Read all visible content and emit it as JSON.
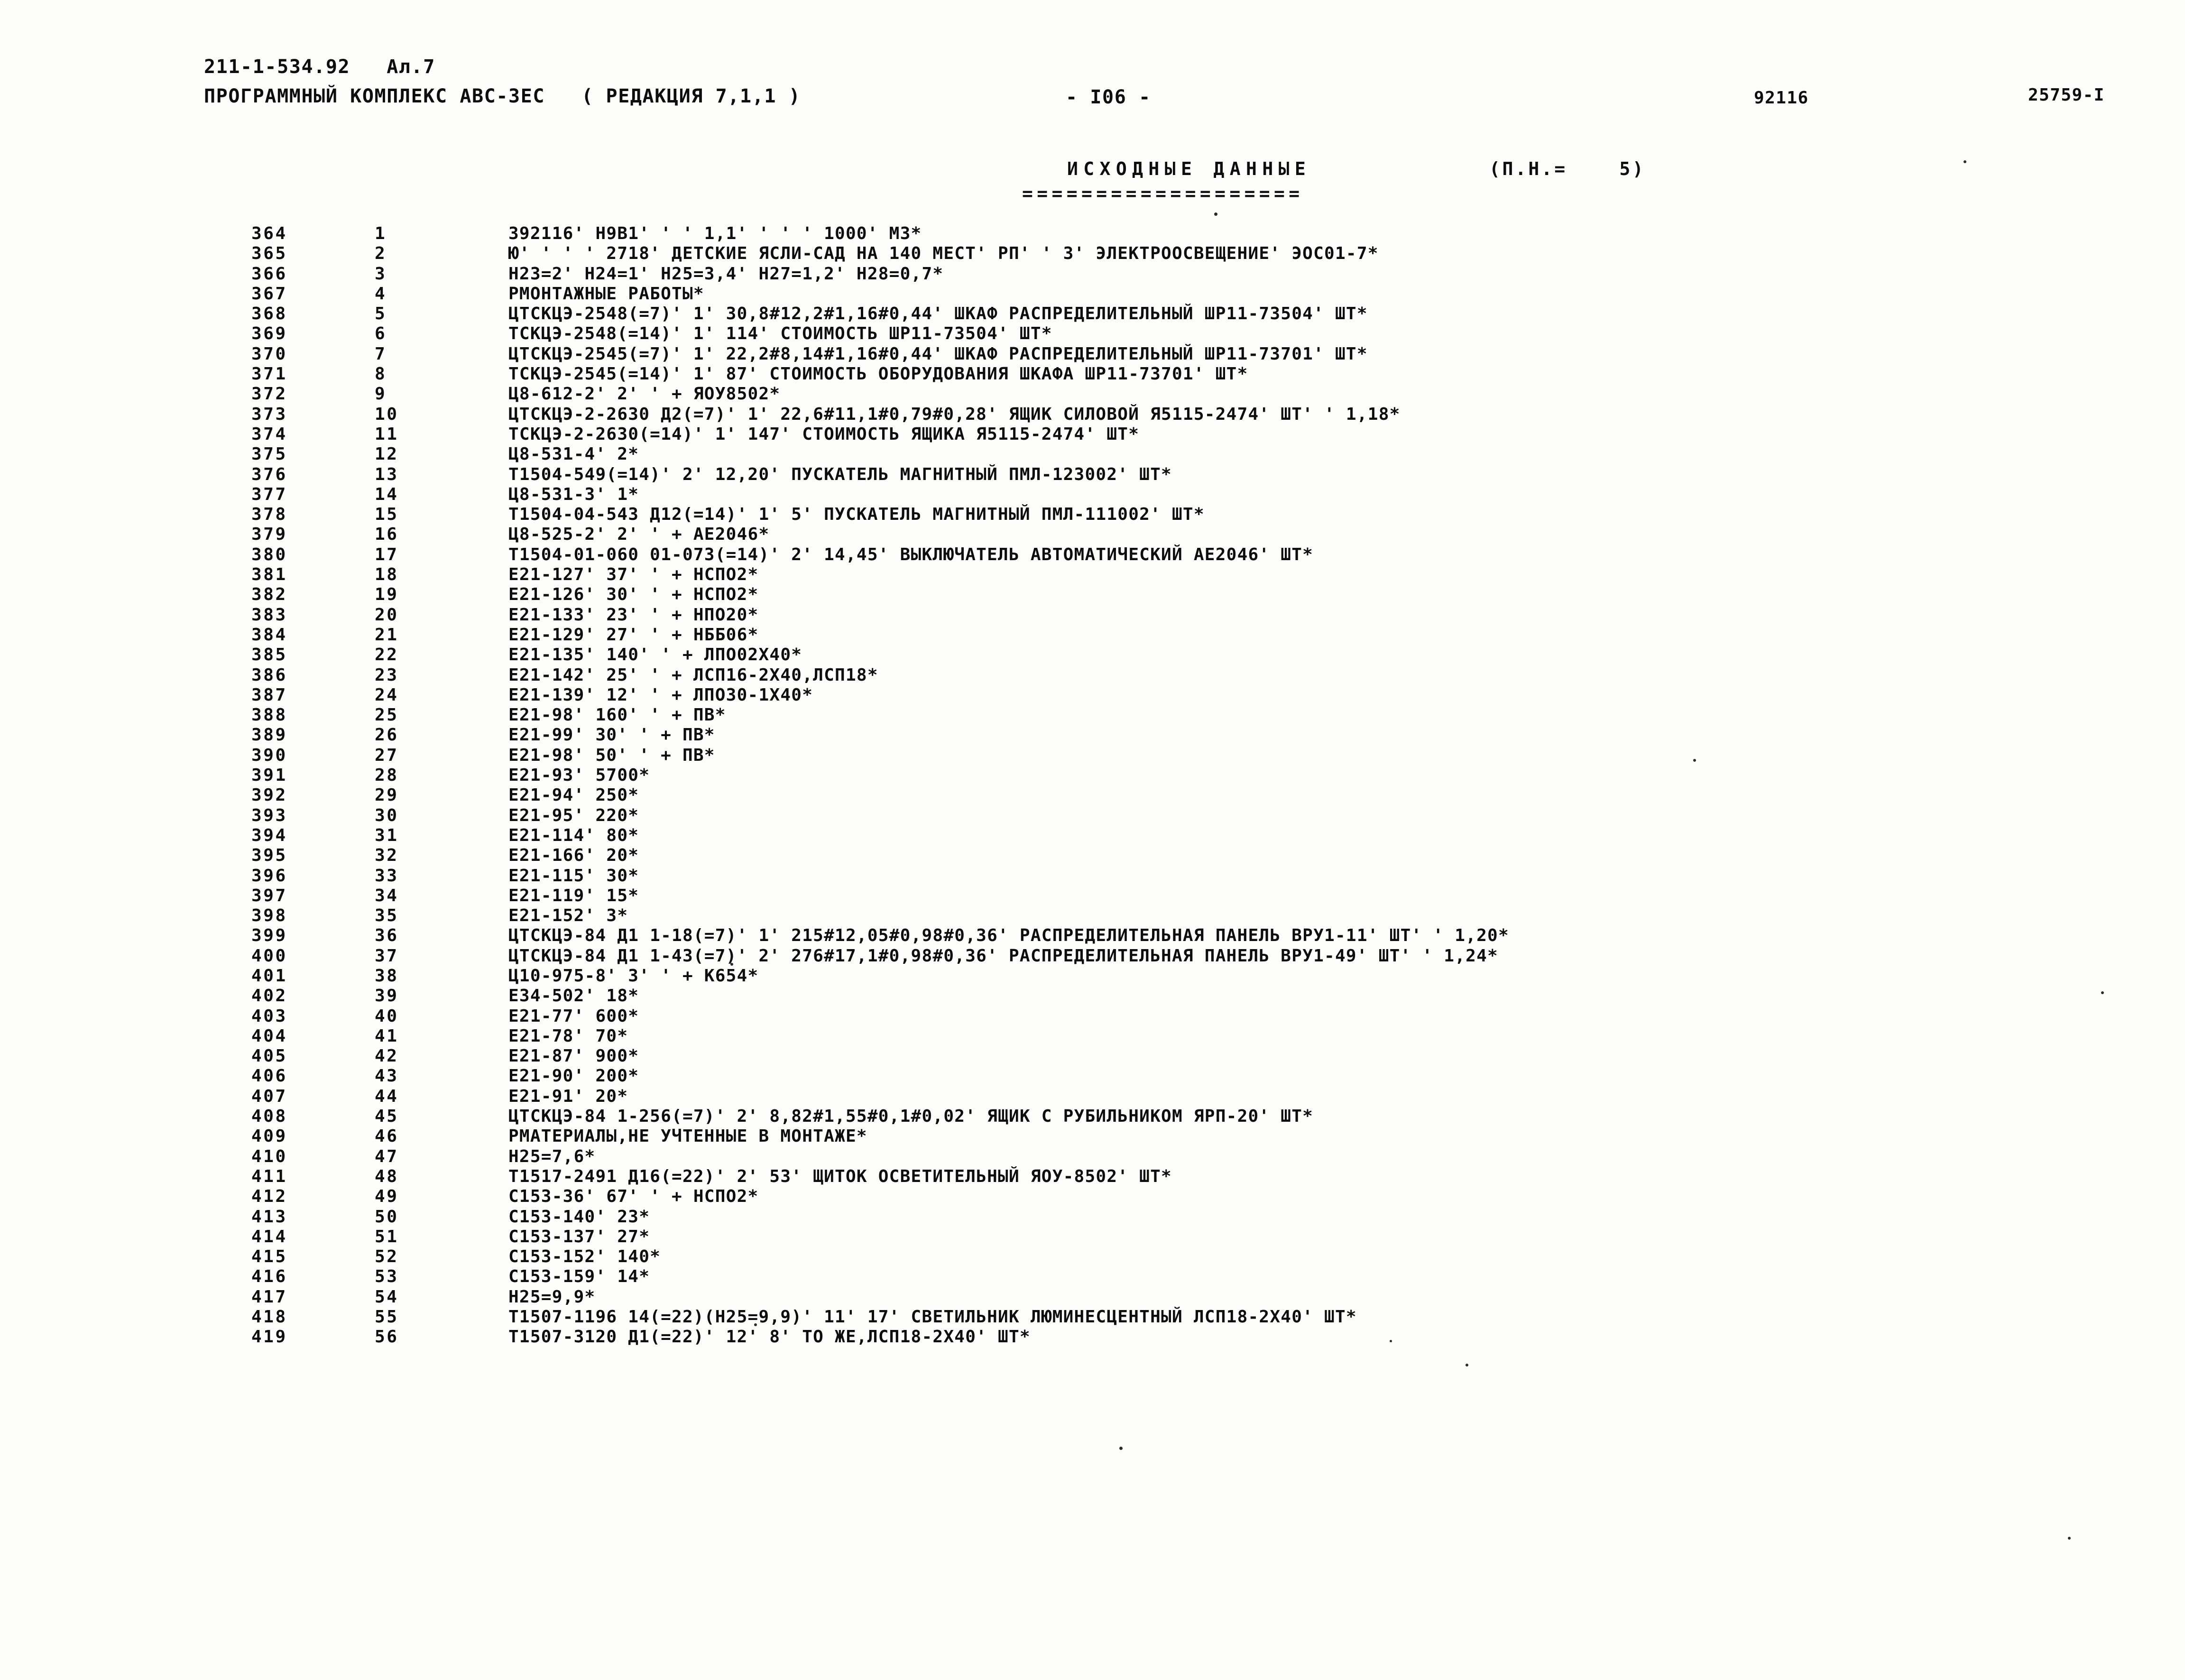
{
  "header": {
    "doc_code": "211-1-534.92   Ал.7",
    "program_title": "ПРОГРАММНЫЙ КОМПЛЕКС АВС-ЗЕС   ( РЕДАКЦИЯ 7,1,1 )",
    "page_number": "- I06 -",
    "order_number": "92116",
    "sheet_number": "25759-I"
  },
  "section": {
    "title": "ИСХОДНЫЕ ДАННЫЕ",
    "param": "(П.Н.=    5)",
    "rule": "==================="
  },
  "listing": {
    "columns": [
      "line_no",
      "seq_no",
      "text"
    ],
    "rows": [
      {
        "line_no": "364",
        "seq_no": "1",
        "text": "392116' Н9В1' ' ' 1,1' ' ' ' 1000' М3*"
      },
      {
        "line_no": "365",
        "seq_no": "2",
        "text": "Ю' ' ' ' 2718' ДЕТСКИЕ ЯСЛИ-САД НА 140 МЕСТ' РП' ' 3' ЭЛЕКТРООСВЕЩЕНИЕ' ЭОС01-7*"
      },
      {
        "line_no": "366",
        "seq_no": "3",
        "text": "Н23=2' Н24=1' Н25=3,4' Н27=1,2' Н28=0,7*"
      },
      {
        "line_no": "367",
        "seq_no": "4",
        "text": "РМОНТАЖНЫЕ РАБОТЫ*"
      },
      {
        "line_no": "368",
        "seq_no": "5",
        "text": "ЦТСКЦЭ-2548(=7)' 1' 30,8#12,2#1,16#0,44' ШКАФ РАСПРЕДЕЛИТЕЛЬНЫЙ ШР11-73504' ШТ*"
      },
      {
        "line_no": "369",
        "seq_no": "6",
        "text": "ТСКЦЭ-2548(=14)' 1' 114' СТОИМОСТЬ ШР11-73504' ШТ*"
      },
      {
        "line_no": "370",
        "seq_no": "7",
        "text": "ЦТСКЦЭ-2545(=7)' 1' 22,2#8,14#1,16#0,44' ШКАФ РАСПРЕДЕЛИТЕЛЬНЫЙ ШР11-73701' ШТ*"
      },
      {
        "line_no": "371",
        "seq_no": "8",
        "text": "ТСКЦЭ-2545(=14)' 1' 87' СТОИМОСТЬ ОБОРУДОВАНИЯ ШКАФА ШР11-73701' ШТ*"
      },
      {
        "line_no": "372",
        "seq_no": "9",
        "text": "Ц8-612-2' 2' ' + ЯОУ8502*"
      },
      {
        "line_no": "373",
        "seq_no": "10",
        "text": "ЦТСКЦЭ-2-2630 Д2(=7)' 1' 22,6#11,1#0,79#0,28' ЯЩИК СИЛОВОЙ Я5115-2474' ШТ' ' 1,18*"
      },
      {
        "line_no": "374",
        "seq_no": "11",
        "text": "ТСКЦЭ-2-2630(=14)' 1' 147' СТОИМОСТЬ ЯЩИКА Я5115-2474' ШТ*"
      },
      {
        "line_no": "375",
        "seq_no": "12",
        "text": "Ц8-531-4' 2*"
      },
      {
        "line_no": "376",
        "seq_no": "13",
        "text": "Т1504-549(=14)' 2' 12,20' ПУСКАТЕЛЬ МАГНИТНЫЙ ПМЛ-123002' ШТ*"
      },
      {
        "line_no": "377",
        "seq_no": "14",
        "text": "Ц8-531-3' 1*"
      },
      {
        "line_no": "378",
        "seq_no": "15",
        "text": "Т1504-04-543 Д12(=14)' 1' 5' ПУСКАТЕЛЬ МАГНИТНЫЙ ПМЛ-111002' ШТ*"
      },
      {
        "line_no": "379",
        "seq_no": "16",
        "text": "Ц8-525-2' 2' ' + АЕ2046*"
      },
      {
        "line_no": "380",
        "seq_no": "17",
        "text": "Т1504-01-060 01-073(=14)' 2' 14,45' ВЫКЛЮЧАТЕЛЬ АВТОМАТИЧЕСКИЙ АЕ2046' ШТ*"
      },
      {
        "line_no": "381",
        "seq_no": "18",
        "text": "Е21-127' 37' ' + НСПО2*"
      },
      {
        "line_no": "382",
        "seq_no": "19",
        "text": "Е21-126' 30' ' + НСПО2*"
      },
      {
        "line_no": "383",
        "seq_no": "20",
        "text": "Е21-133' 23' ' + НПО20*"
      },
      {
        "line_no": "384",
        "seq_no": "21",
        "text": "Е21-129' 27' ' + НББ06*"
      },
      {
        "line_no": "385",
        "seq_no": "22",
        "text": "Е21-135' 140' ' + ЛПО02Х40*"
      },
      {
        "line_no": "386",
        "seq_no": "23",
        "text": "Е21-142' 25' ' + ЛСП16-2Х40,ЛСП18*"
      },
      {
        "line_no": "387",
        "seq_no": "24",
        "text": "Е21-139' 12' ' + ЛПО30-1Х40*"
      },
      {
        "line_no": "388",
        "seq_no": "25",
        "text": "Е21-98' 160' ' + ПВ*"
      },
      {
        "line_no": "389",
        "seq_no": "26",
        "text": "Е21-99' 30' ' + ПВ*"
      },
      {
        "line_no": "390",
        "seq_no": "27",
        "text": "Е21-98' 50' ' + ПВ*"
      },
      {
        "line_no": "391",
        "seq_no": "28",
        "text": "Е21-93' 5700*"
      },
      {
        "line_no": "392",
        "seq_no": "29",
        "text": "Е21-94' 250*"
      },
      {
        "line_no": "393",
        "seq_no": "30",
        "text": "Е21-95' 220*"
      },
      {
        "line_no": "394",
        "seq_no": "31",
        "text": "Е21-114' 80*"
      },
      {
        "line_no": "395",
        "seq_no": "32",
        "text": "Е21-166' 20*"
      },
      {
        "line_no": "396",
        "seq_no": "33",
        "text": "Е21-115' 30*"
      },
      {
        "line_no": "397",
        "seq_no": "34",
        "text": "Е21-119' 15*"
      },
      {
        "line_no": "398",
        "seq_no": "35",
        "text": "Е21-152' 3*"
      },
      {
        "line_no": "399",
        "seq_no": "36",
        "text": "ЦТСКЦЭ-84 Д1 1-18(=7)' 1' 215#12,05#0,98#0,36' РАСПРЕДЕЛИТЕЛЬНАЯ ПАНЕЛЬ ВРУ1-11' ШТ' ' 1,20*"
      },
      {
        "line_no": "400",
        "seq_no": "37",
        "text": "ЦТСКЦЭ-84 Д1 1-43(=7)' 2' 276#17,1#0,98#0,36' РАСПРЕДЕЛИТЕЛЬНАЯ ПАНЕЛЬ ВРУ1-49' ШТ' ' 1,24*"
      },
      {
        "line_no": "401",
        "seq_no": "38",
        "text": "Ц10-975-8' 3' ' + К654*"
      },
      {
        "line_no": "402",
        "seq_no": "39",
        "text": "Е34-502' 18*"
      },
      {
        "line_no": "403",
        "seq_no": "40",
        "text": "Е21-77' 600*"
      },
      {
        "line_no": "404",
        "seq_no": "41",
        "text": "Е21-78' 70*"
      },
      {
        "line_no": "405",
        "seq_no": "42",
        "text": "Е21-87' 900*"
      },
      {
        "line_no": "406",
        "seq_no": "43",
        "text": "Е21-90' 200*"
      },
      {
        "line_no": "407",
        "seq_no": "44",
        "text": "Е21-91' 20*"
      },
      {
        "line_no": "408",
        "seq_no": "45",
        "text": "ЦТСКЦЭ-84 1-256(=7)' 2' 8,82#1,55#0,1#0,02' ЯЩИК С РУБИЛЬНИКОМ ЯРП-20' ШТ*"
      },
      {
        "line_no": "409",
        "seq_no": "46",
        "text": "РМАТЕРИАЛЫ,НЕ УЧТЕННЫЕ В МОНТАЖЕ*"
      },
      {
        "line_no": "410",
        "seq_no": "47",
        "text": "Н25=7,6*"
      },
      {
        "line_no": "411",
        "seq_no": "48",
        "text": "Т1517-2491 Д16(=22)' 2' 53' ЩИТОК ОСВЕТИТЕЛЬНЫЙ ЯОУ-8502' ШТ*"
      },
      {
        "line_no": "412",
        "seq_no": "49",
        "text": "С153-36' 67' ' + НСПО2*"
      },
      {
        "line_no": "413",
        "seq_no": "50",
        "text": "С153-140' 23*"
      },
      {
        "line_no": "414",
        "seq_no": "51",
        "text": "С153-137' 27*"
      },
      {
        "line_no": "415",
        "seq_no": "52",
        "text": "С153-152' 140*"
      },
      {
        "line_no": "416",
        "seq_no": "53",
        "text": "С153-159' 14*"
      },
      {
        "line_no": "417",
        "seq_no": "54",
        "text": "Н25=9,9*"
      },
      {
        "line_no": "418",
        "seq_no": "55",
        "text": "Т1507-1196 14(=22)(Н25=9,9)' 11' 17' СВЕТИЛЬНИК ЛЮМИНЕСЦЕНТНЫЙ ЛСП18-2Х40' ШТ*"
      },
      {
        "line_no": "419",
        "seq_no": "56",
        "text": "Т1507-3120 Д1(=22)' 12' 8' ТО ЖЕ,ЛСП18-2Х40' ШТ*"
      }
    ]
  },
  "colors": {
    "paper": "#fdfdfb",
    "ink": "#0d0d0d"
  }
}
